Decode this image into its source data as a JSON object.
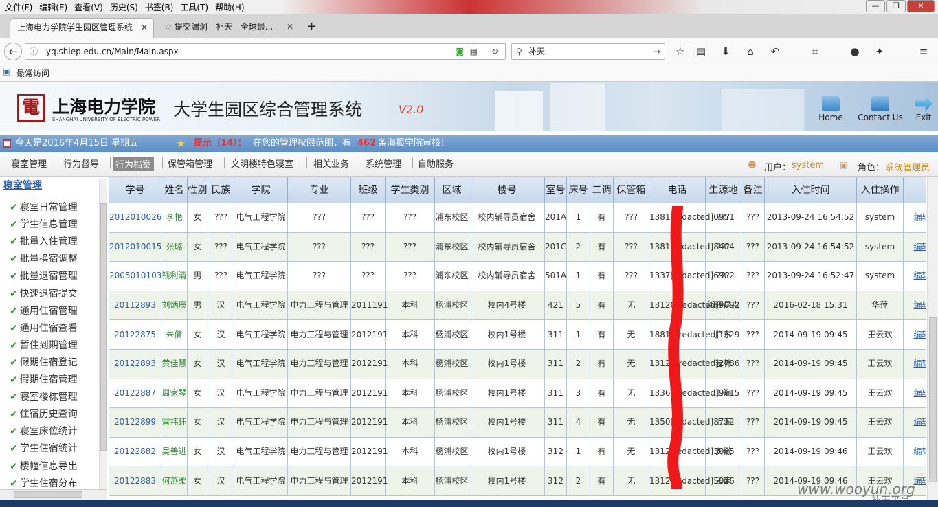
{
  "menu": [
    "文件(F)",
    "编辑(E)",
    "查看(V)",
    "历史(S)",
    "书签(B)",
    "工具(T)",
    "帮助(H)"
  ],
  "tabs": [
    {
      "label": "上海电力学院学生园区管理系统"
    },
    {
      "label": "提交漏洞 - 补天 - 全球最..."
    }
  ],
  "url": "yq.shiep.edu.cn/Main/Main.aspx",
  "search_value": "补天",
  "bookmark": "最常访问",
  "header": {
    "school": "上海电力学院",
    "school_en": "SHANGHAI UNIVERSITY OF ELECTRIC POWER",
    "system": "大学生园区综合管理系统",
    "version": "V2.0",
    "home": "Home",
    "contact": "Contact Us",
    "exit": "Exit"
  },
  "status": {
    "date": "今天是2016年4月15日 星期五",
    "tip": "提示（14）：",
    "msg1": "在您的管理权限范围，有",
    "count": "462",
    "msg2": "条海报学院审核！"
  },
  "subnav": [
    "寝室管理",
    "行为督导",
    "行为档案",
    "保管箱管理",
    "文明楼特色寝室",
    "相关业务",
    "系统管理",
    "自助服务"
  ],
  "user": {
    "label": "用户：",
    "value": "system",
    "role_label": "角色：",
    "role": "系统管理员"
  },
  "sidebar": {
    "title": "寝室管理",
    "items": [
      "寝室日常管理",
      "学生信息管理",
      "批量入住管理",
      "批量换宿调整",
      "批量退宿管理",
      "快速退宿提交",
      "通用住宿管理",
      "通用住宿查看",
      "暂住到期管理",
      "假期住宿登记",
      "假期住宿管理",
      "寝室楼栋管理",
      "住宿历史查询",
      "寝室床位统计",
      "学生住宿统计",
      "楼幢信息导出",
      "学生住宿分布"
    ]
  },
  "table": {
    "headers": [
      "学号",
      "姓名",
      "性别",
      "民族",
      "学院",
      "专业",
      "班级",
      "学生类别",
      "区域",
      "楼号",
      "室号",
      "床号",
      "二调",
      "保管箱",
      "电话",
      "生源地",
      "备注",
      "入住时间",
      "入住操作",
      ""
    ],
    "rows": [
      [
        "2012010026",
        "李艳",
        "女",
        "???",
        "电气工程学院",
        "???",
        "???",
        "???",
        "浦东校区",
        "校内辅导员宿舍",
        "201A",
        "1",
        "有",
        "???",
        "1381[redacted]0951",
        "???",
        "???",
        "2013-09-24 16:54:52",
        "system",
        "编辑"
      ],
      [
        "2012010015",
        "张璐",
        "女",
        "???",
        "电气工程学院",
        "???",
        "???",
        "???",
        "浦东校区",
        "校内辅导员宿舍",
        "201C",
        "2",
        "有",
        "???",
        "1381[redacted]8404",
        "???",
        "???",
        "2013-09-24 16:54:52",
        "system",
        "编辑"
      ],
      [
        "2005010103",
        "钱利清",
        "男",
        "???",
        "电气工程学院",
        "???",
        "???",
        "???",
        "浦东校区",
        "校内辅导员宿舍",
        "501A",
        "1",
        "有",
        "???",
        "1337[redacted]6902",
        "???",
        "???",
        "2013-09-24 16:52:47",
        "system",
        "编辑"
      ],
      [
        "20112893",
        "刘炳辰",
        "男",
        "汉",
        "电气工程学院",
        "电力工程与管理",
        "2011191",
        "本科",
        "杨浦校区",
        "校内4号楼",
        "421",
        "5",
        "有",
        "无",
        "13120[redacted]9092",
        "新疆昌吉",
        "???",
        "2016-02-18 15:31",
        "华萍",
        "编辑"
      ],
      [
        "20122875",
        "朱倩",
        "女",
        "汉",
        "电气工程学院",
        "电力工程与管理",
        "2012191",
        "本科",
        "杨浦校区",
        "校内1号楼",
        "311",
        "1",
        "有",
        "无",
        "18817[redacted]1329",
        "广东",
        "???",
        "2014-09-19 09:45",
        "王云欢",
        "编辑"
      ],
      [
        "20122893",
        "黄佳慧",
        "女",
        "汉",
        "电气工程学院",
        "电力工程与管理",
        "2012191",
        "本科",
        "杨浦校区",
        "校内1号楼",
        "311",
        "2",
        "有",
        "无",
        "13120[redacted]2786",
        "吉林",
        "???",
        "2014-09-19 09:45",
        "王云欢",
        "编辑"
      ],
      [
        "20122887",
        "周家琴",
        "女",
        "汉",
        "电气工程学院",
        "电力工程与管理",
        "2012191",
        "本科",
        "杨浦校区",
        "校内1号楼",
        "311",
        "3",
        "有",
        "无",
        "13367[redacted]9615",
        "上海",
        "???",
        "2014-09-19 09:45",
        "王云欢",
        "编辑"
      ],
      [
        "20122899",
        "雷祎珏",
        "女",
        "汉",
        "电气工程学院",
        "电力工程与管理",
        "2012191",
        "本科",
        "杨浦校区",
        "校内1号楼",
        "311",
        "4",
        "有",
        "无",
        "1350[redacted]8732",
        "上海",
        "???",
        "2014-09-19 09:45",
        "王云欢",
        "编辑"
      ],
      [
        "20122882",
        "吴善进",
        "女",
        "汉",
        "电气工程学院",
        "电力工程与管理",
        "2012191",
        "本科",
        "杨浦校区",
        "校内1号楼",
        "312",
        "1",
        "有",
        "无",
        "1312[redacted]3065",
        "安徽",
        "???",
        "2014-09-19 09:46",
        "王云欢",
        "编辑"
      ],
      [
        "20122883",
        "何燕柔",
        "女",
        "汉",
        "电气工程学院",
        "电力工程与管理",
        "2012191",
        "本科",
        "杨浦校区",
        "校内1号楼",
        "312",
        "2",
        "有",
        "无",
        "1312[redacted]5026",
        "云南",
        "???",
        "2014-09-19 09:46",
        "王云欢",
        "编辑"
      ]
    ]
  },
  "watermark": "www.wooyun.org",
  "watermark2": "补天平台"
}
